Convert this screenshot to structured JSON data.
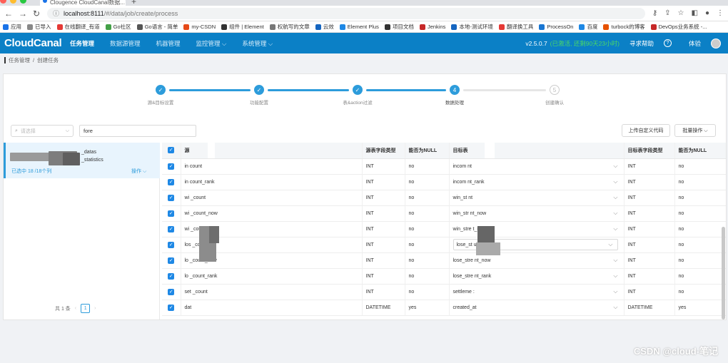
{
  "browser": {
    "tab_title": "Clougence CloudCanal数据...",
    "url_host": "localhost:8111",
    "url_path": "/#/data/job/create/process",
    "bookmarks": [
      "应用",
      "已导入",
      "在线翻译_有道",
      "Go社区",
      "Go语言 - 简单",
      "my-CSDN",
      "组件 | Element",
      "权航写的文章",
      "云效",
      "Element Plus",
      "项目文档",
      "Jenkins",
      "本地-测试环境",
      "翻译换工具",
      "ProcessOn",
      "百度",
      "turbock的博客",
      "DevOps业务系统 -..."
    ]
  },
  "app": {
    "logo": "CloudCanal",
    "menu": [
      "任务管理",
      "数据源管理",
      "机器管理",
      "监控管理 ⌵",
      "系统管理 ⌵"
    ],
    "version": "v2.5.0.7",
    "license": "(已激活, 还剩90天23小时)",
    "help": "寻求帮助",
    "user": "体验"
  },
  "breadcrumb": [
    "任务管理",
    "创建任务"
  ],
  "steps": [
    {
      "label": "源&目标设置",
      "state": "done",
      "num": "✓"
    },
    {
      "label": "功能配置",
      "state": "done",
      "num": "✓"
    },
    {
      "label": "表&action过滤",
      "state": "done",
      "num": "✓"
    },
    {
      "label": "数据处理",
      "state": "current",
      "num": "4"
    },
    {
      "label": "创建确认",
      "state": "wait",
      "num": "5"
    }
  ],
  "toolbar": {
    "select_placeholder": "请选择",
    "search_value": "fore",
    "upload_button": "上传自定义代码",
    "batch_button": "批量操作 ⌵"
  },
  "left_panel": {
    "table_line1": "_datas",
    "table_line2": "_statistics",
    "selected_info": "已选中 18 /18个列",
    "ops_label": "操作 ⌵",
    "total": "共 1 条",
    "page": "1"
  },
  "columns": {
    "headers": [
      "",
      "源",
      "源表字段类型",
      "能否为NULL",
      "目标表",
      "目标表字段类型",
      "能否为NULL"
    ],
    "rows": [
      {
        "src": "in     count",
        "src_type": "INT",
        "src_null": "no",
        "dst": "incom       nt",
        "dst_type": "INT",
        "dst_null": "no"
      },
      {
        "src": "in     count_rank",
        "src_type": "INT",
        "src_null": "no",
        "dst": "incom       nt_rank",
        "dst_type": "INT",
        "dst_null": "no"
      },
      {
        "src": "wi       _count",
        "src_type": "INT",
        "src_null": "no",
        "dst": "win_st       nt",
        "dst_type": "INT",
        "dst_null": "no"
      },
      {
        "src": "wi       _count_now",
        "src_type": "INT",
        "src_null": "no",
        "dst": "win_str       nt_now",
        "dst_type": "INT",
        "dst_null": "no"
      },
      {
        "src": "wi       _count_rank",
        "src_type": "INT",
        "src_null": "no",
        "dst": "win_stre       t_rank",
        "dst_type": "INT",
        "dst_null": "no"
      },
      {
        "src": "los       _count",
        "src_type": "INT",
        "src_null": "no",
        "dst": "lose_st       unt",
        "dst_type": "INT",
        "dst_null": "no"
      },
      {
        "src": "lo       _count_now",
        "src_type": "INT",
        "src_null": "no",
        "dst": "lose_stre       nt_now",
        "dst_type": "INT",
        "dst_null": "no"
      },
      {
        "src": "lo       _count_rank",
        "src_type": "INT",
        "src_null": "no",
        "dst": "lose_stre       nt_rank",
        "dst_type": "INT",
        "dst_null": "no"
      },
      {
        "src": "set       _count",
        "src_type": "INT",
        "src_null": "no",
        "dst": "settleme       :",
        "dst_type": "INT",
        "dst_null": "no"
      },
      {
        "src": "dat",
        "src_type": "DATETIME",
        "src_null": "yes",
        "dst": "created_at",
        "dst_type": "DATETIME",
        "dst_null": "yes"
      }
    ]
  },
  "watermark": "CSDN @cloud-笔记"
}
